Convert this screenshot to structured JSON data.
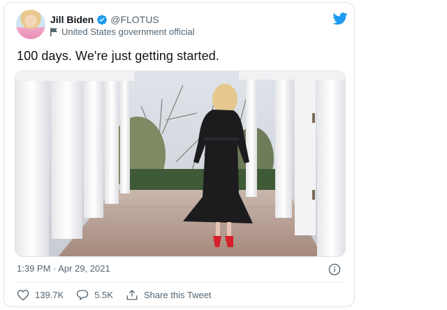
{
  "tweet": {
    "author_name": "Jill Biden",
    "handle": "@FLOTUS",
    "account_label": "United States government official",
    "text": "100 days. We're just getting started.",
    "timestamp": "1:39 PM · Apr 29, 2021",
    "likes": "139.7K",
    "replies": "5.5K",
    "share_label": "Share this Tweet"
  },
  "icons": {
    "verified": "verified-badge-icon",
    "label": "flag-icon",
    "brand": "twitter-bird-icon",
    "info": "info-icon",
    "like": "heart-icon",
    "reply": "speech-bubble-icon",
    "share": "share-icon"
  },
  "colors": {
    "brand": "#1d9bf0",
    "secondary_text": "#536471",
    "border": "#dfe3e7"
  }
}
